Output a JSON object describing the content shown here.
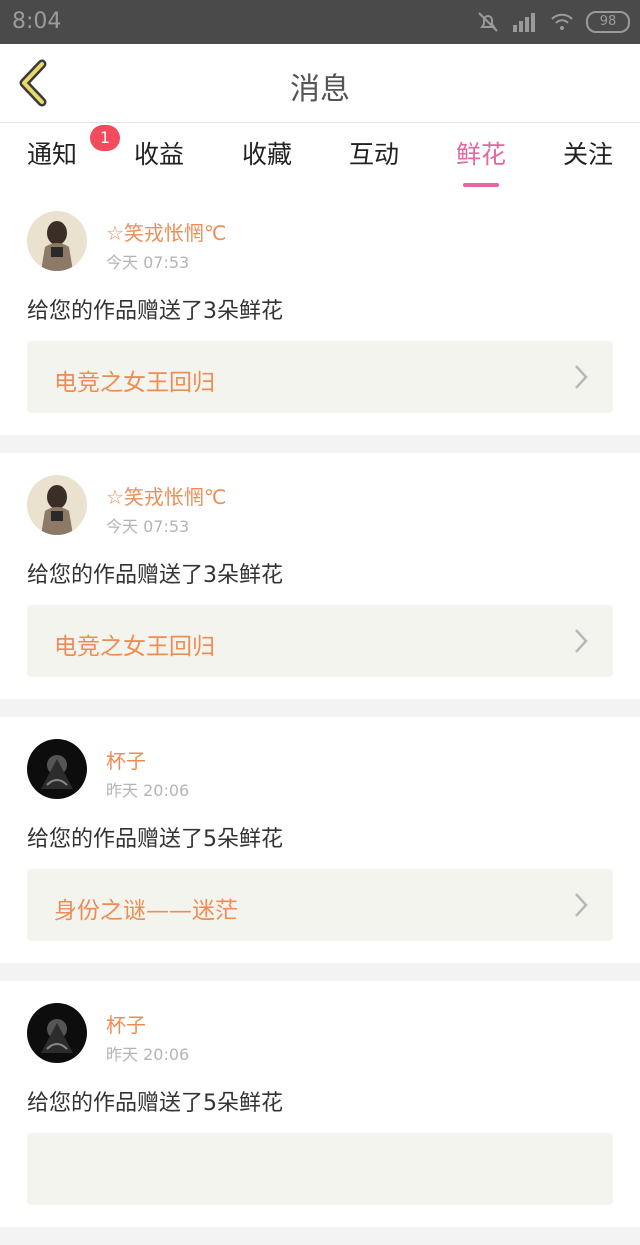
{
  "status": {
    "time": "8:04",
    "battery": "98"
  },
  "header": {
    "title": "消息"
  },
  "tabs": [
    {
      "label": "通知",
      "badge": "1"
    },
    {
      "label": "收益"
    },
    {
      "label": "收藏"
    },
    {
      "label": "互动"
    },
    {
      "label": "鲜花",
      "active": true
    },
    {
      "label": "关注"
    }
  ],
  "colors": {
    "accent": "#e367a0",
    "username": "#ef8c56",
    "badge": "#f24c5c"
  },
  "feed": [
    {
      "user": "☆笑戎怅惘℃",
      "time": "今天 07:53",
      "message": "给您的作品赠送了3朵鲜花",
      "work": "电竞之女王回归"
    },
    {
      "user": "☆笑戎怅惘℃",
      "time": "今天 07:53",
      "message": "给您的作品赠送了3朵鲜花",
      "work": "电竞之女王回归"
    },
    {
      "user": "杯子",
      "time": "昨天 20:06",
      "message": "给您的作品赠送了5朵鲜花",
      "work": "身份之谜——迷茫"
    },
    {
      "user": "杯子",
      "time": "昨天 20:06",
      "message": "给您的作品赠送了5朵鲜花",
      "work": ""
    }
  ]
}
